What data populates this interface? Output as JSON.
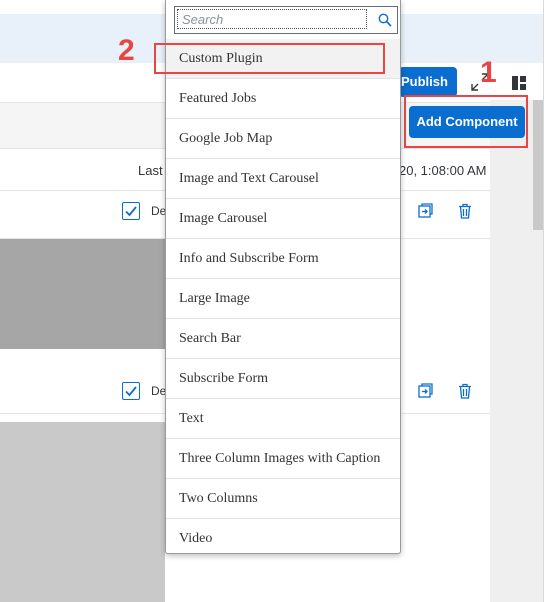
{
  "toolbar": {
    "publish_label": "Publish",
    "add_component_label": "Add Component"
  },
  "annotations": {
    "step1": "1",
    "step2": "2"
  },
  "table": {
    "column_last": "Last",
    "date_value": "20, 1:08:00 AM",
    "row1": {
      "checked": true,
      "label": "De"
    },
    "row2": {
      "checked": true,
      "label": "De"
    }
  },
  "dropdown": {
    "search_placeholder": "Search",
    "items": [
      "Custom Plugin",
      "Featured Jobs",
      "Google Job Map",
      "Image and Text Carousel",
      "Image Carousel",
      "Info and Subscribe Form",
      "Large Image",
      "Search Bar",
      "Subscribe Form",
      "Text",
      "Three Column Images with Caption",
      "Two Columns",
      "Video"
    ]
  },
  "colors": {
    "accent": "#0a6ed1",
    "annotation_red": "#e84545"
  },
  "icons": [
    "search-icon",
    "fullscreen-icon",
    "layout-icon",
    "copy-icon",
    "trash-icon",
    "checkmark-icon"
  ]
}
